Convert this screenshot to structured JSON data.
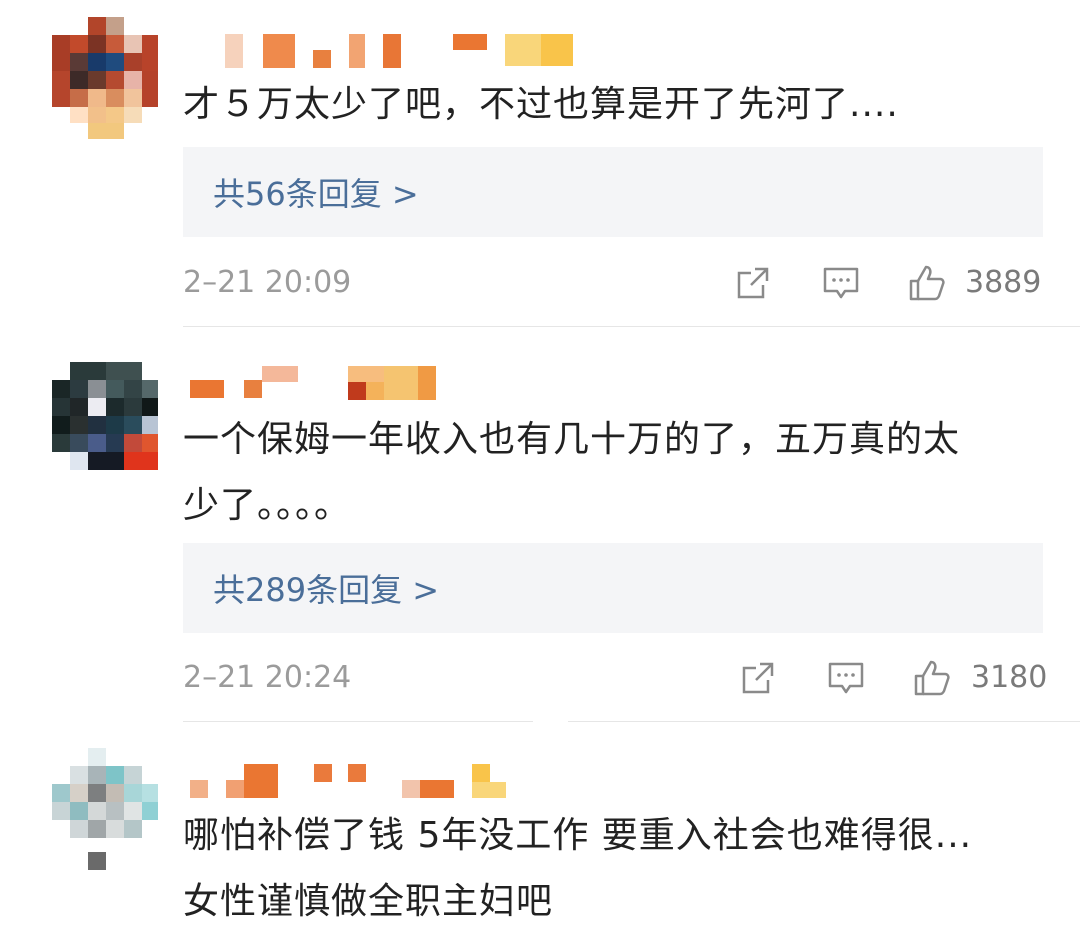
{
  "comments": [
    {
      "text_lines": [
        "才５万太少了吧，不过也算是开了先河了...."
      ],
      "reply_label": "共56条回复 >",
      "timestamp": "2–21 20:09",
      "likes": "3889"
    },
    {
      "text_lines": [
        "一个保姆一年收入也有几十万的了，五万真的太",
        "少了。。。。"
      ],
      "reply_label": "共289条回复 >",
      "timestamp": "2–21 20:24",
      "likes": "3180"
    },
    {
      "text_lines": [
        "哪怕补偿了钱  5年没工作 要重入社会也难得很...",
        "女性谨慎做全职主妇吧"
      ]
    }
  ],
  "icons": {
    "share": "share-icon",
    "comment": "comment-icon",
    "like": "thumbs-up-icon"
  },
  "colors": {
    "reply_link": "#4a6e99",
    "reply_bg": "#f4f5f7",
    "meta_text": "#9b9b9b",
    "body_text": "#222222"
  }
}
